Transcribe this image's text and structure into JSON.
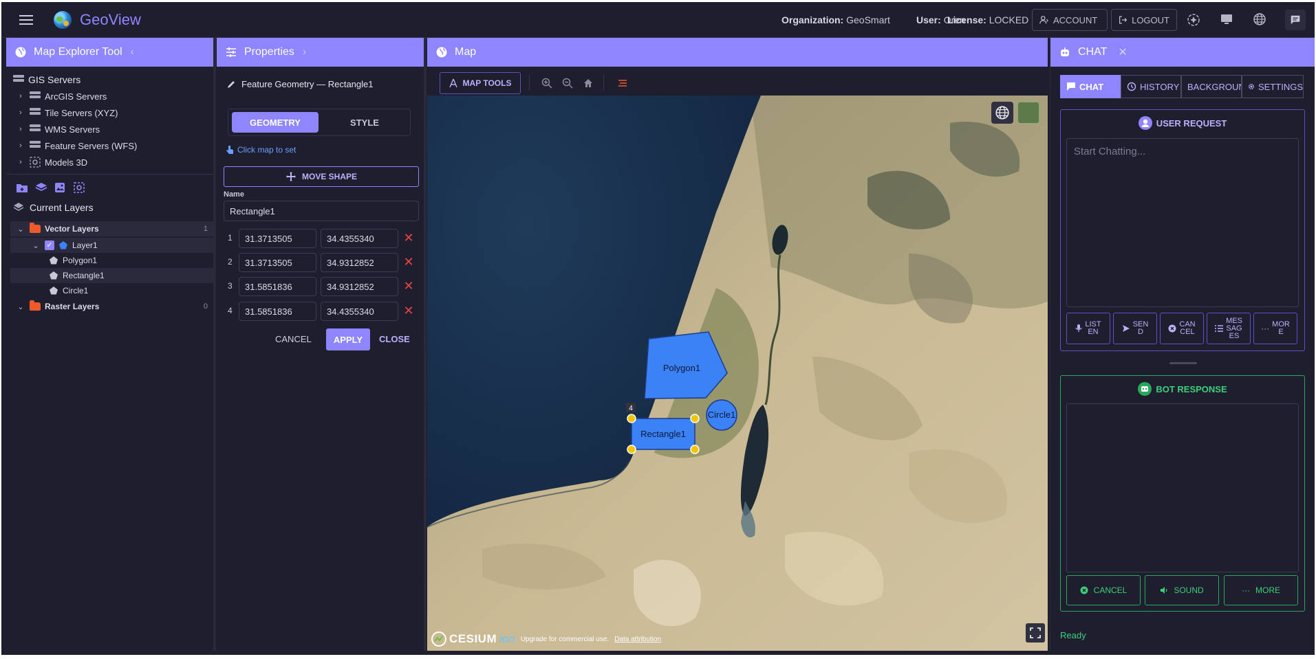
{
  "app": {
    "name": "GeoView"
  },
  "topbar": {
    "org_label": "Organization:",
    "org_value": "GeoSmart",
    "user_label": "User:",
    "user_value": "Oren",
    "license_label": "License:",
    "license_value": "LOCKED",
    "account_label": "ACCOUNT",
    "logout_label": "LOGOUT"
  },
  "explorer": {
    "title": "Map Explorer Tool",
    "gis_servers": "GIS Servers",
    "servers": [
      "ArcGIS Servers",
      "Tile Servers (XYZ)",
      "WMS Servers",
      "Feature Servers (WFS)",
      "Models 3D"
    ],
    "current_layers": "Current Layers",
    "vector_layers": {
      "label": "Vector Layers",
      "count": "1"
    },
    "layer1": "Layer1",
    "features": [
      "Polygon1",
      "Rectangle1",
      "Circle1"
    ],
    "raster_layers": {
      "label": "Raster Layers",
      "count": "0"
    }
  },
  "properties": {
    "title": "Properties",
    "subtitle": "Feature Geometry — Rectangle1",
    "tabs": [
      "GEOMETRY",
      "STYLE"
    ],
    "click_hint": "Click map to set",
    "move_shape": "MOVE SHAPE",
    "name_label": "Name",
    "name_value": "Rectangle1",
    "coords": [
      {
        "index": "1",
        "lat": "31.3713505",
        "lon": "34.4355340"
      },
      {
        "index": "2",
        "lat": "31.3713505",
        "lon": "34.9312852"
      },
      {
        "index": "3",
        "lat": "31.5851836",
        "lon": "34.9312852"
      },
      {
        "index": "4",
        "lat": "31.5851836",
        "lon": "34.4355340"
      }
    ],
    "cancel": "CANCEL",
    "apply": "APPLY",
    "close": "CLOSE"
  },
  "map": {
    "title": "Map",
    "tools_label": "MAP TOOLS",
    "shapes": {
      "polygon": "Polygon1",
      "rectangle": "Rectangle1",
      "circle": "Circle1",
      "vertex_index": "4"
    },
    "cesium": "CESIUM",
    "ion": "ion",
    "upgrade": "Upgrade for commercial use.",
    "attribution": "Data attribution"
  },
  "chat": {
    "title": "CHAT",
    "tabs": [
      "CHAT",
      "HISTORY",
      "BACKGROUND",
      "SETTINGS"
    ],
    "user_request": "USER REQUEST",
    "placeholder": "Start Chatting...",
    "actions": [
      {
        "line1": "LIST",
        "line2": "EN",
        "line3": ""
      },
      {
        "line1": "SEN",
        "line2": "D",
        "line3": ""
      },
      {
        "line1": "CAN",
        "line2": "CEL",
        "line3": ""
      },
      {
        "line1": "MES",
        "line2": "SAG",
        "line3": "ES"
      },
      {
        "line1": "MOR",
        "line2": "E",
        "line3": ""
      }
    ],
    "bot_response": "BOT RESPONSE",
    "bottom_actions": [
      "CANCEL",
      "SOUND",
      "MORE"
    ],
    "status": "Ready"
  },
  "colors": {
    "accent": "#8f86ff",
    "background": "#1e1e2e",
    "danger": "#ef4444",
    "success": "#3cd07a",
    "folder": "#f0592a",
    "shape_fill": "#3b82f6"
  }
}
